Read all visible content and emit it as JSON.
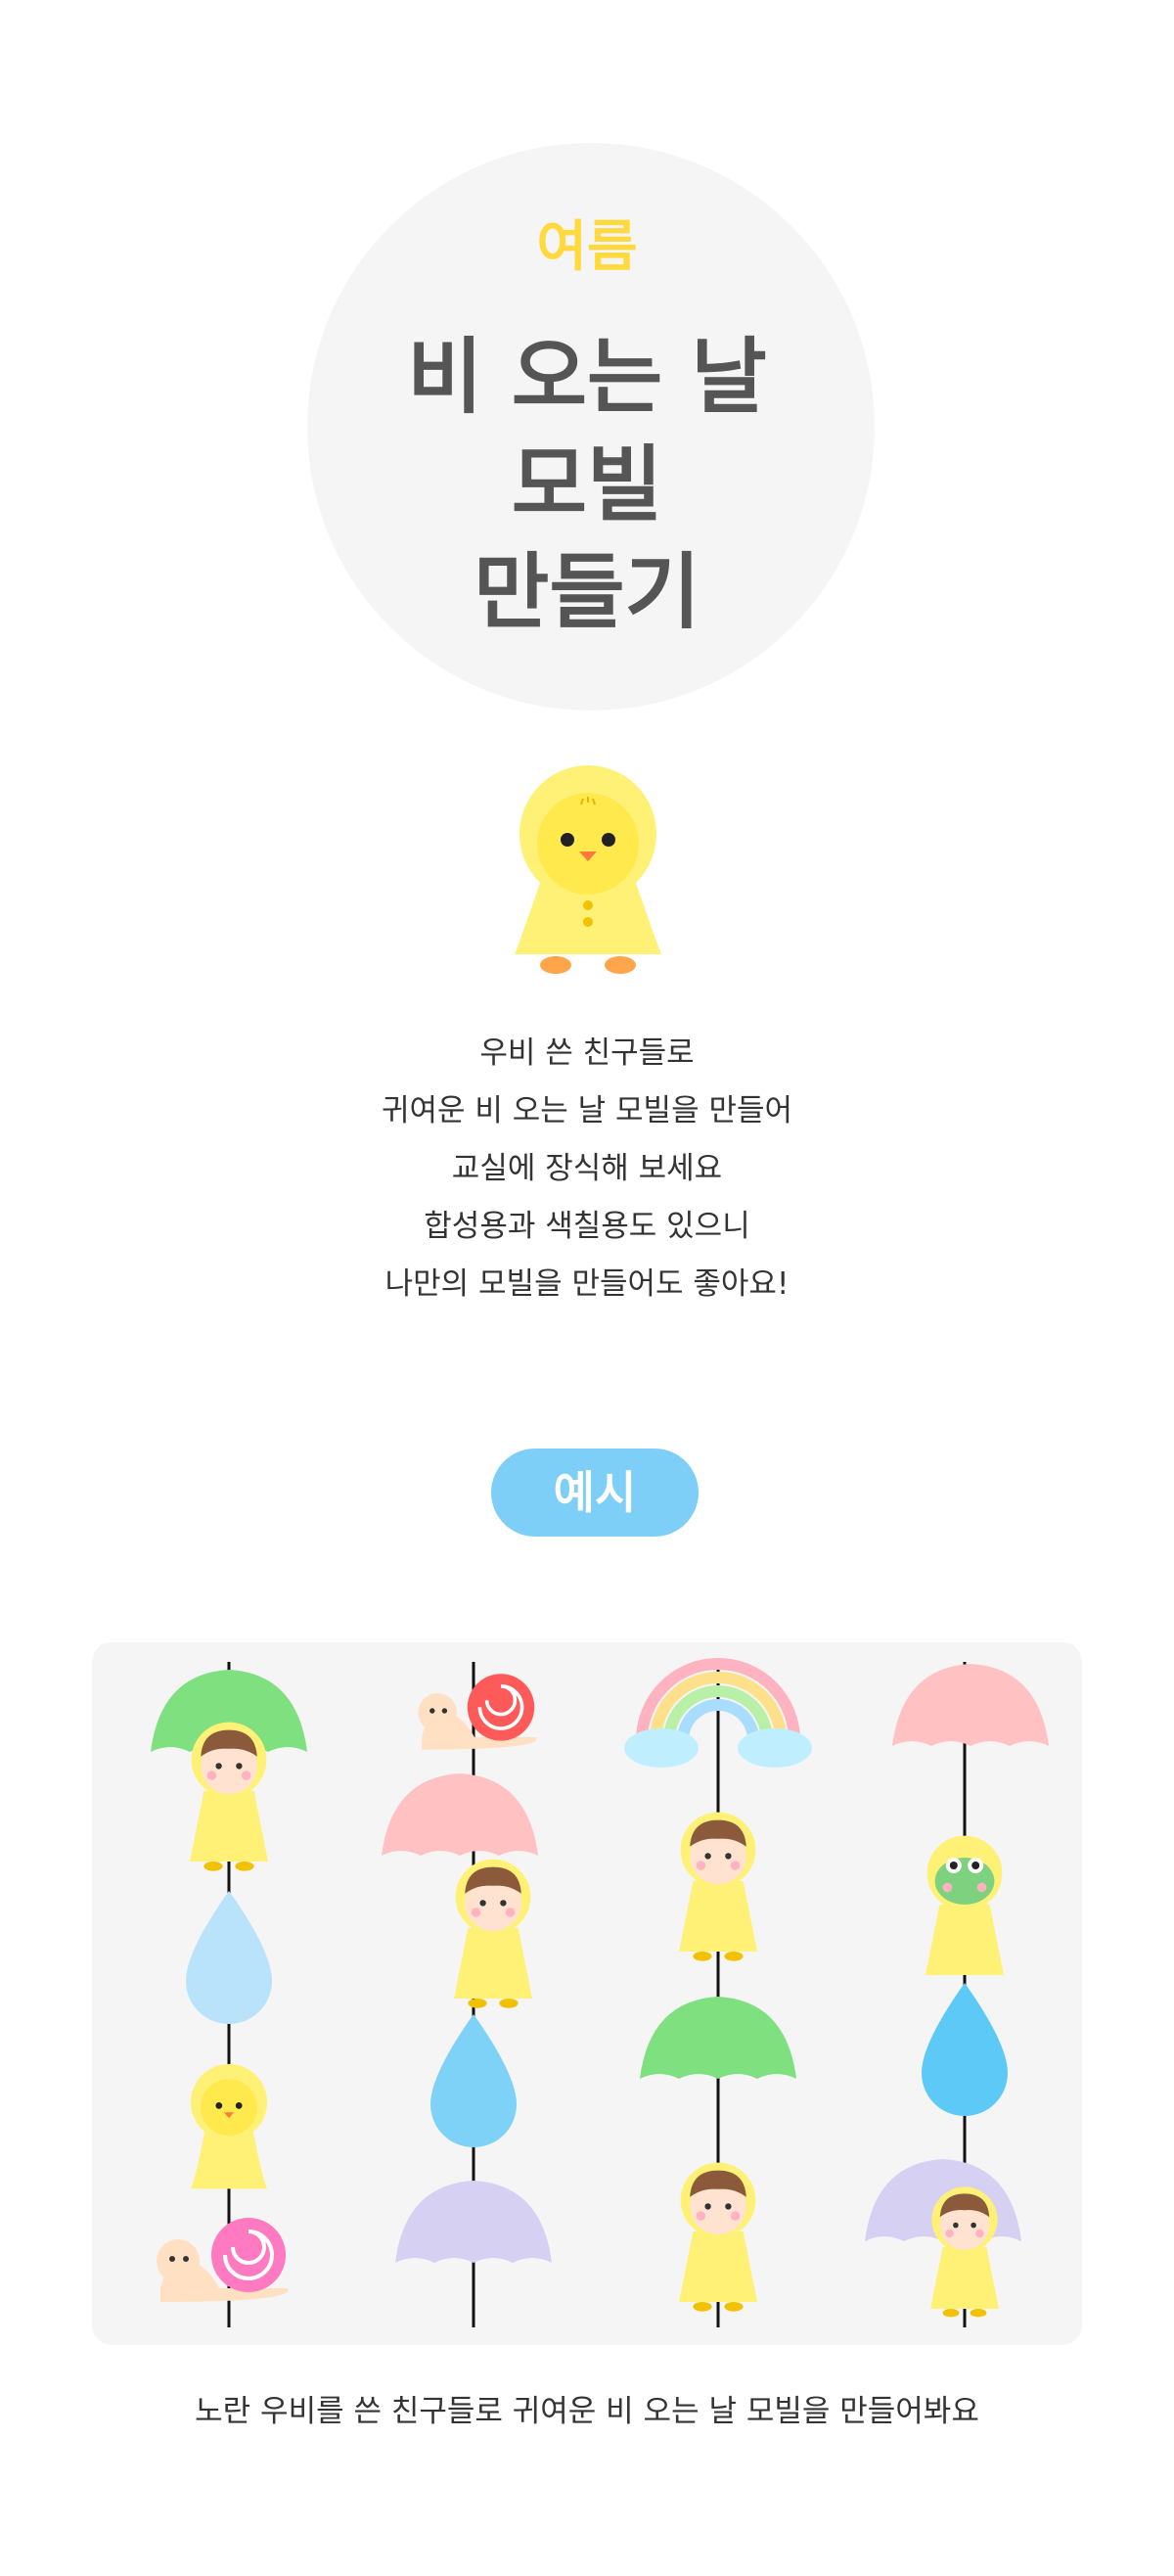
{
  "hero": {
    "season": "여름",
    "title_lines": [
      "비 오는 날",
      "모빌",
      "만들기"
    ]
  },
  "intro": {
    "lines": [
      "우비 쓴 친구들로",
      "귀여운 비 오는 날 모빌을 만들어",
      "교실에 장식해 보세요",
      "합성용과 색칠용도 있으니",
      "나만의 모빌을 만들어도 좋아요!"
    ]
  },
  "example": {
    "label": "예시",
    "caption": "노란 우비를 쓴 친구들로 귀여운 비 오는 날 모빌을 만들어봐요"
  },
  "colors": {
    "season_yellow": "#ffd93d",
    "title_gray": "#555555",
    "pill_blue": "#7ecff7",
    "panel_gray": "#f5f5f5"
  },
  "icons": [
    "chick-raincoat-icon",
    "umbrella-icon",
    "raindrop-icon",
    "snail-icon",
    "rainbow-icon",
    "frog-raincoat-icon",
    "child-raincoat-icon"
  ]
}
